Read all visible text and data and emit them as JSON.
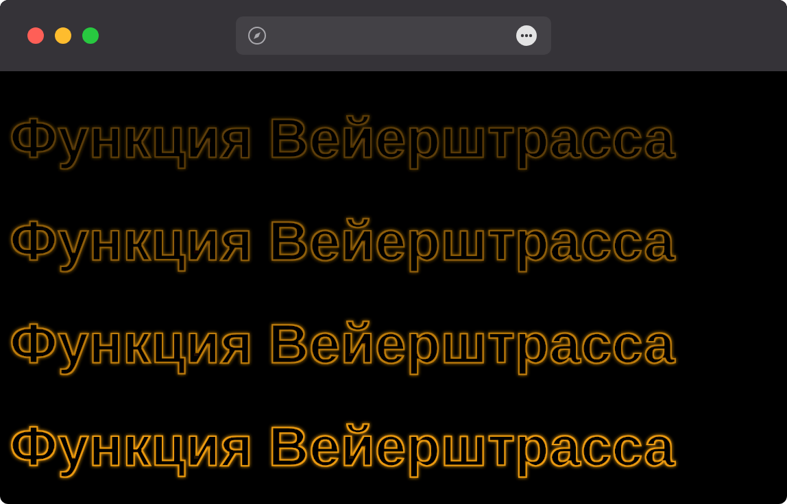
{
  "lines": [
    {
      "text": "Функция Вейерштрасса",
      "color": "#5c3d08"
    },
    {
      "text": "Функция Вейерштрасса",
      "color": "#8f5e0b"
    },
    {
      "text": "Функция Вейерштрасса",
      "color": "#bd7c0e"
    },
    {
      "text": "Функция Вейерштрасса",
      "color": "#ea9a12"
    }
  ]
}
